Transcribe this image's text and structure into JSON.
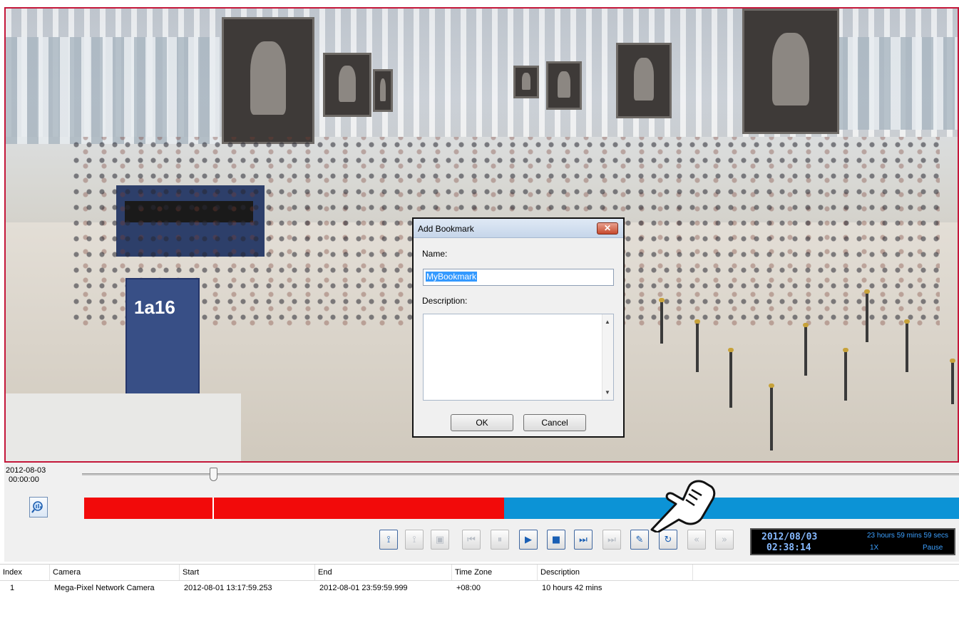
{
  "dialog": {
    "title": "Add Bookmark",
    "close_glyph": "✕",
    "name_label": "Name:",
    "name_value": "MyBookmark",
    "description_label": "Description:",
    "description_value": "",
    "ok_label": "OK",
    "cancel_label": "Cancel"
  },
  "playback": {
    "start_date": "2012-08-03",
    "start_time": "00:00:00",
    "slider_position": 0.15,
    "recorded_fraction": 0.48,
    "controls": [
      {
        "name": "mark-in-button",
        "glyph": "⟟",
        "enabled": true
      },
      {
        "name": "mark-out-button",
        "glyph": "⟟",
        "enabled": false
      },
      {
        "name": "export-button",
        "glyph": "▣",
        "enabled": false
      },
      {
        "name": "previous-segment-button",
        "glyph": "⏮",
        "enabled": false
      },
      {
        "name": "pause-button",
        "glyph": "⏸",
        "enabled": false
      },
      {
        "name": "play-button",
        "glyph": "▶",
        "enabled": true
      },
      {
        "name": "stop-button",
        "glyph": "■",
        "enabled": true
      },
      {
        "name": "next-frame-button",
        "glyph": "⏭",
        "enabled": true
      },
      {
        "name": "next-segment-button",
        "glyph": "⏭",
        "enabled": false
      },
      {
        "name": "add-bookmark-button",
        "glyph": "✎",
        "enabled": true
      },
      {
        "name": "refresh-button",
        "glyph": "↻",
        "enabled": true
      },
      {
        "name": "slower-button",
        "glyph": "«",
        "enabled": false
      },
      {
        "name": "faster-button",
        "glyph": "»",
        "enabled": false
      }
    ],
    "display": {
      "date": "2012/08/03",
      "time": "02:38:14",
      "duration": "23 hours 59 mins 59 secs",
      "speed": "1X",
      "state": "Pause"
    }
  },
  "bookmarks": {
    "columns": [
      "Index",
      "Camera",
      "Start",
      "End",
      "Time Zone",
      "Description"
    ],
    "rows": [
      {
        "index": "1",
        "camera": "Mega-Pixel Network Camera",
        "start": "2012-08-01 13:17:59.253",
        "end": "2012-08-01 23:59:59.999",
        "time_zone": "+08:00",
        "description": "10 hours 42 mins"
      }
    ]
  },
  "colors": {
    "video_border": "#c4173a",
    "recorded": "#f20a0a",
    "timeline": "#0c93d6",
    "active_control": "#1a5fb4",
    "disabled_control": "#b6bcc4"
  }
}
